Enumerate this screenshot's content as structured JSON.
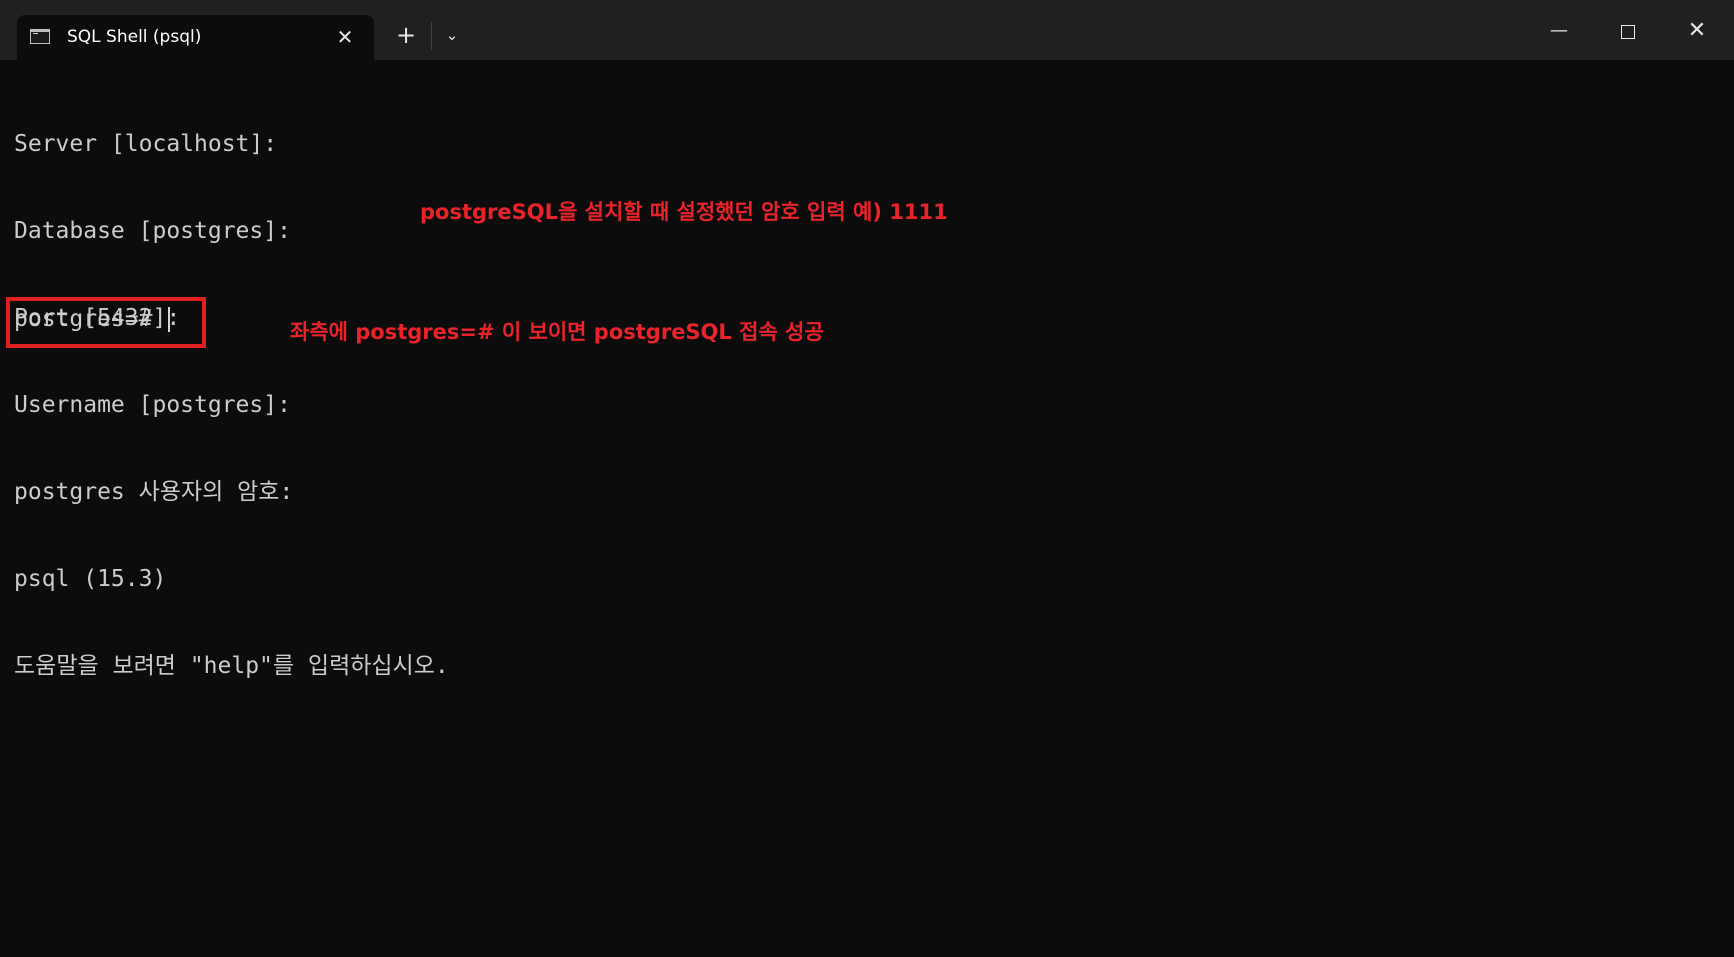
{
  "window": {
    "tab_title": "SQL Shell (psql)",
    "tab_close_symbol": "✕",
    "new_tab_symbol": "+",
    "dropdown_symbol": "⌄",
    "minimize_symbol": "—",
    "close_symbol": "✕"
  },
  "terminal": {
    "lines": [
      "Server [localhost]:",
      "Database [postgres]:",
      "Port [5432]:",
      "Username [postgres]:",
      "postgres 사용자의 암호:",
      "psql (15.3)",
      "도움말을 보려면 \"help\"를 입력하십시오."
    ],
    "prompt": "postgres=#"
  },
  "annotations": {
    "password_note": "postgreSQL을 설치할 때 설정했던 암호 입력  예) 1111",
    "success_note": "좌측에 postgres=# 이 보이면 postgreSQL 접속 성공"
  },
  "colors": {
    "terminal_bg": "#0c0c0c",
    "titlebar_bg": "#202020",
    "terminal_text": "#cccccc",
    "annotation_red": "#e8232a"
  },
  "icons": {
    "tab": "terminal-icon",
    "tab_close": "close-icon",
    "new_tab": "plus-icon",
    "dropdown": "chevron-down-icon",
    "minimize": "minimize-icon",
    "maximize": "maximize-icon",
    "close": "close-icon"
  }
}
